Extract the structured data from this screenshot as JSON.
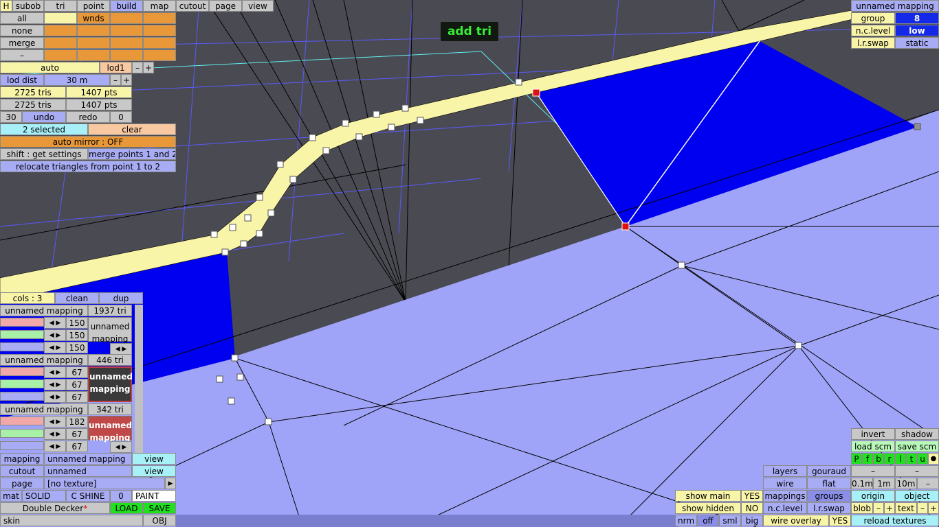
{
  "overlay": {
    "mode": "add tri"
  },
  "tabs": [
    "H",
    "subob",
    "tri",
    "point",
    "build",
    "map",
    "cutout",
    "page",
    "view"
  ],
  "sel": {
    "all": "all",
    "none": "none",
    "merge": "merge",
    "minus": "–",
    "wnds": "wnds"
  },
  "lod": {
    "auto": "auto",
    "lod1": "lod1",
    "minus": "–",
    "plus": "+",
    "dist_label": "lod dist",
    "dist_value": "30 m"
  },
  "stats": {
    "tris1": "2725 tris",
    "pts1": "1407 pts",
    "tris2": "2725 tris",
    "pts2": "1407 pts"
  },
  "undo": {
    "count": "30",
    "undo": "undo",
    "redo": "redo",
    "redo_count": "0"
  },
  "selection": {
    "selected": "2 selected",
    "clear": "clear",
    "auto_mirror": "auto mirror : OFF",
    "shift": "shift : get settings",
    "merge_points": "merge points 1 and 2",
    "relocate": "relocate triangles from point 1 to 2"
  },
  "mapping_top": {
    "title": "unnamed mapping",
    "group_label": "group",
    "group_value": "8",
    "nc_label": "n.c.level",
    "nc_value": "low",
    "lr_label": "l.r.swap",
    "lr_value": "static"
  },
  "cols": {
    "label": "cols : 3",
    "clean": "clean",
    "dup": "dup"
  },
  "mappings": [
    {
      "name": "unnamed mapping",
      "tris": "1937 tri",
      "values": [
        "150",
        "150",
        "150"
      ],
      "preview": "unnamed mapping",
      "levels": [
        0.6,
        0.6,
        0.6,
        0.6
      ]
    },
    {
      "name": "unnamed mapping",
      "tris": "446 tri",
      "values": [
        "67",
        "67",
        "67"
      ],
      "preview": "unnamed mapping",
      "levels": [
        0.6,
        0.6,
        0.6,
        0.6
      ]
    },
    {
      "name": "unnamed mapping",
      "tris": "342 tri",
      "values": [
        "182",
        "67",
        "67"
      ],
      "preview": "unnamed mapping",
      "levels": [
        0.6,
        0.6,
        0.6,
        0.6
      ]
    }
  ],
  "props": {
    "mapping_label": "mapping",
    "mapping_value": "unnamed mapping",
    "view": "view",
    "cutout_label": "cutout",
    "cutout_value": "unnamed",
    "page_label": "page",
    "page_value": "[no texture]",
    "play": "▶",
    "mat": "mat",
    "solid": "SOLID",
    "cshine": "C SHINE",
    "zero": "0",
    "paint": "PAINT",
    "model": "Double Decker",
    "star": "*",
    "load": "LOAD",
    "save": "SAVE",
    "skin": "skin",
    "obj": "OBJ"
  },
  "right": {
    "invert": "invert",
    "shadow": "shadow",
    "load_scm": "load scm",
    "save_scm": "save scm",
    "flags": [
      "P",
      "f",
      "b",
      "r",
      "l",
      "t",
      "u",
      "●"
    ],
    "dash1": "–",
    "dash2": "–",
    "layers": "layers",
    "gouraud": "gouraud",
    "wire": "wire",
    "flat": "flat",
    "s01": "0.1m",
    "s1": "1m",
    "s10": "10m",
    "sminus": "–",
    "mappings": "mappings",
    "groups": "groups",
    "origin": "origin",
    "object": "object",
    "nc_level": "n.c.level",
    "lr_swap": "l.r.swap",
    "blob": "blob",
    "text": "text",
    "minus": "–",
    "plus": "+",
    "wire_overlay": "wire overlay",
    "yes": "YES",
    "reload": "reload textures",
    "show_main": "show main",
    "show_hidden": "show hidden",
    "no": "NO",
    "nrm": "nrm",
    "off": "off",
    "sml": "sml",
    "big": "big"
  },
  "colors": {
    "accent_blue": "#1428e8",
    "selected_vertex": "#e01010",
    "road": "#f8f4a8",
    "ground": "#a0a4f8"
  }
}
